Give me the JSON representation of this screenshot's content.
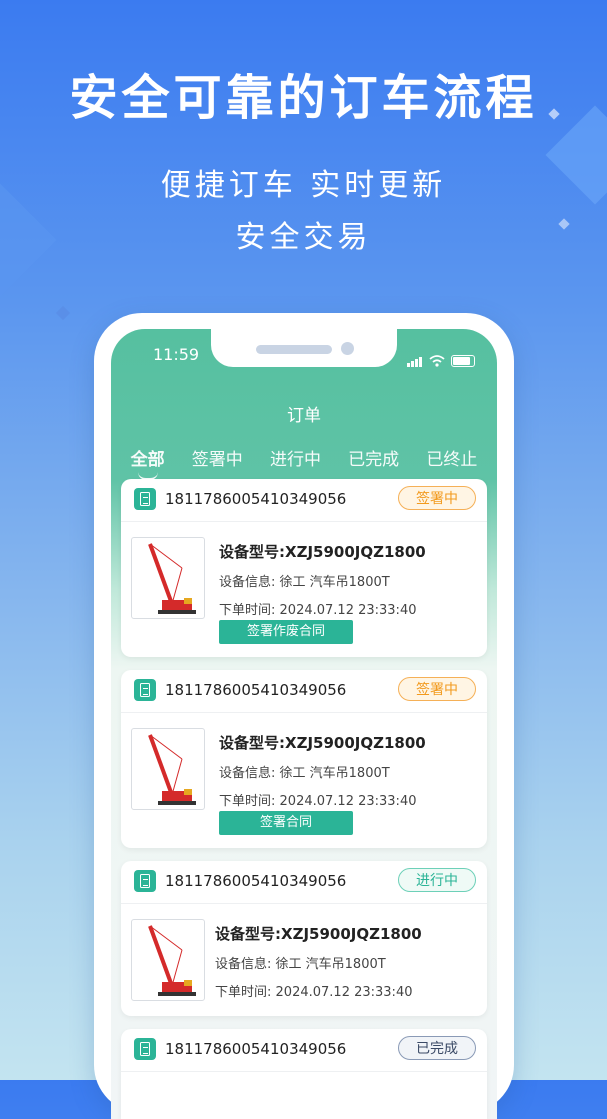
{
  "promo": {
    "headline": "安全可靠的订车流程",
    "sub_line1": "便捷订车 实时更新",
    "sub_line2": "安全交易"
  },
  "status_bar": {
    "time": "11:59"
  },
  "page": {
    "title": "订单",
    "tabs": [
      {
        "label": "全部",
        "active": true
      },
      {
        "label": "签署中",
        "active": false
      },
      {
        "label": "进行中",
        "active": false
      },
      {
        "label": "已完成",
        "active": false
      },
      {
        "label": "已终止",
        "active": false
      }
    ]
  },
  "orders": [
    {
      "order_no": "1811786005410349056",
      "status": "签署中",
      "model": "设备型号:XZJ5900JQZ1800",
      "info_label": "设备信息:",
      "info_value": "徐工 汽车吊1800T",
      "time_label": "下单时间:",
      "time_value": "2024.07.12 23:33:40",
      "action": "签署作废合同"
    },
    {
      "order_no": "1811786005410349056",
      "status": "签署中",
      "model": "设备型号:XZJ5900JQZ1800",
      "info_label": "设备信息:",
      "info_value": "徐工 汽车吊1800T",
      "time_label": "下单时间:",
      "time_value": "2024.07.12 23:33:40",
      "action": "签署合同"
    },
    {
      "order_no": "1811786005410349056",
      "status": "进行中",
      "model": "设备型号:XZJ5900JQZ1800",
      "info_label": "设备信息:",
      "info_value": "徐工 汽车吊1800T",
      "time_label": "下单时间:",
      "time_value": "2024.07.12 23:33:40"
    },
    {
      "order_no": "1811786005410349056",
      "status": "已完成"
    }
  ],
  "colors": {
    "accent": "#2bb497",
    "header": "#56c0a0",
    "signing": "#f29a1e",
    "background_top": "#3b7bf0"
  }
}
